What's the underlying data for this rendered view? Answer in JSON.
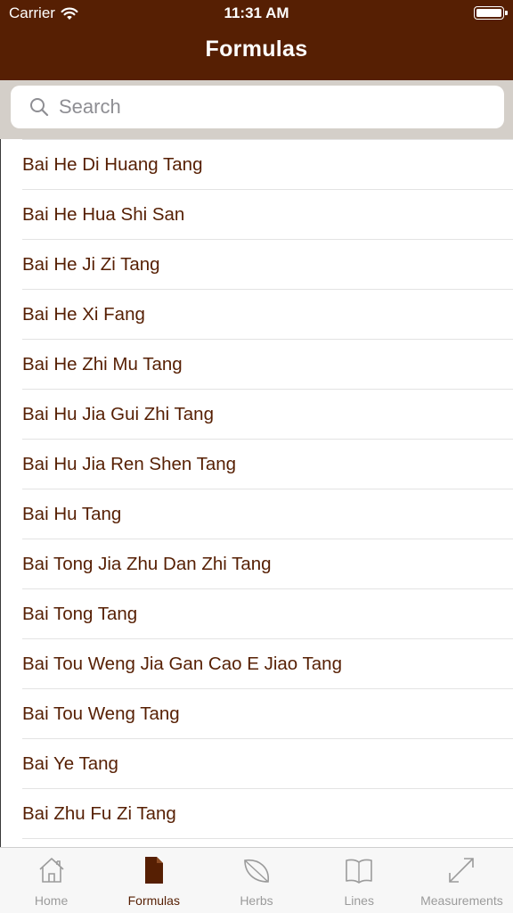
{
  "status_bar": {
    "carrier": "Carrier",
    "time": "11:31 AM"
  },
  "nav": {
    "title": "Formulas"
  },
  "search": {
    "placeholder": "Search",
    "value": ""
  },
  "formulas": [
    "Bai He Di Huang Tang",
    "Bai He Hua Shi San",
    "Bai He Ji Zi Tang",
    "Bai He Xi Fang",
    "Bai He Zhi Mu Tang",
    "Bai Hu Jia Gui Zhi Tang",
    "Bai Hu Jia Ren Shen Tang",
    "Bai Hu Tang",
    "Bai Tong Jia Zhu Dan Zhi Tang",
    "Bai Tong Tang",
    "Bai Tou Weng Jia Gan Cao E Jiao Tang",
    "Bai Tou Weng Tang",
    "Bai Ye Tang",
    "Bai Zhu Fu Zi Tang"
  ],
  "tabs": [
    {
      "label": "Home",
      "icon": "home-icon",
      "active": false
    },
    {
      "label": "Formulas",
      "icon": "document-icon",
      "active": true
    },
    {
      "label": "Herbs",
      "icon": "leaf-icon",
      "active": false
    },
    {
      "label": "Lines",
      "icon": "book-icon",
      "active": false
    },
    {
      "label": "Measurements",
      "icon": "measure-arrows-icon",
      "active": false
    }
  ],
  "colors": {
    "brand": "#561f03",
    "search_bar_bg": "#d4cfc9",
    "tab_inactive": "#9b9b9b"
  }
}
